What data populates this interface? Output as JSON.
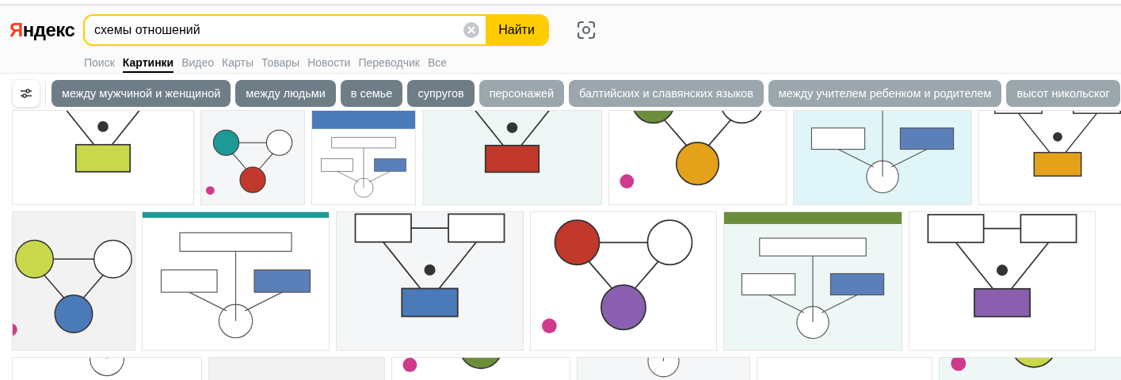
{
  "logo": "Яндекс",
  "search": {
    "value": "схемы отношений",
    "button": "Найти"
  },
  "nav_tabs": [
    {
      "label": "Поиск",
      "selected": false
    },
    {
      "label": "Картинки",
      "selected": true
    },
    {
      "label": "Видео",
      "selected": false
    },
    {
      "label": "Карты",
      "selected": false
    },
    {
      "label": "Товары",
      "selected": false
    },
    {
      "label": "Новости",
      "selected": false
    },
    {
      "label": "Переводчик",
      "selected": false
    },
    {
      "label": "Все",
      "selected": false
    }
  ],
  "suggestion_chips": [
    {
      "label": "между мужчиной и женщиной",
      "dimmed": false
    },
    {
      "label": "между людьми",
      "dimmed": false
    },
    {
      "label": "в семье",
      "dimmed": false
    },
    {
      "label": "супругов",
      "dimmed": false
    },
    {
      "label": "персонажей",
      "dimmed": true
    },
    {
      "label": "балтийских и славянских языков",
      "dimmed": true
    },
    {
      "label": "между учителем ребенком и родителем",
      "dimmed": true
    },
    {
      "label": "высот никольског",
      "dimmed": true
    }
  ]
}
